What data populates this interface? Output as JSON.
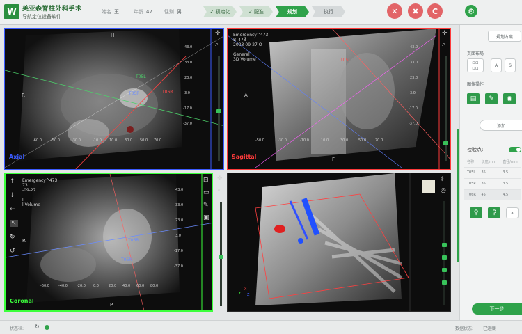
{
  "header": {
    "logo": "W",
    "title": "美亚森脊柱外科手术",
    "subtitle": "导航定位设备软件",
    "patient": {
      "name_label": "姓名",
      "name_value": "王",
      "age_label": "年龄",
      "age_value": "47",
      "sex_label": "性别",
      "sex_value": "男"
    },
    "steps": [
      {
        "label": "初始化",
        "state": "done"
      },
      {
        "label": "配准",
        "state": "done"
      },
      {
        "label": "规划",
        "state": "active"
      },
      {
        "label": "执行",
        "state": "pending"
      }
    ],
    "buttons": [
      {
        "name": "tools-icon",
        "glyph": "✕"
      },
      {
        "name": "robot-arm-icon",
        "glyph": "✖"
      },
      {
        "name": "camera-icon",
        "glyph": "C"
      },
      {
        "name": "tracker-icon",
        "glyph": "⚙"
      }
    ]
  },
  "viewports": {
    "common": {
      "emergency": "Emergency^473",
      "id": "B_473",
      "date": "2023-09-27 O",
      "series1": "General",
      "series2": "3D Volume"
    },
    "axial": {
      "label": "Axial",
      "label_color": "#3b5bff",
      "orient_top": "H",
      "orient_left": "R",
      "scale": [
        "43.0",
        "33.0",
        "23.0",
        "3.0",
        "-17.0",
        "-37.0"
      ],
      "ticks": [
        "-60.0",
        "-50.0",
        "-30.0",
        "-10.0",
        "10.0",
        "30.0",
        "50.0",
        "70.0"
      ],
      "screw_labels": [
        "T05L",
        "T05R",
        "T06R"
      ]
    },
    "sagittal": {
      "label": "Sagittal",
      "label_color": "#ff3b3b",
      "orient_left": "A",
      "orient_bottom": "F",
      "scale": [
        "43.0",
        "33.0",
        "23.0",
        "3.0",
        "-17.0",
        "-37.0"
      ],
      "ticks": [
        "-50.0",
        "-30.0",
        "-10.0",
        "10.0",
        "30.0",
        "50.0",
        "70.0"
      ],
      "screw_labels": [
        "T05L"
      ]
    },
    "coronal": {
      "label": "Coronal",
      "label_color": "#3bff3b",
      "emergency": "Emergency^473",
      "id": "73",
      "date": "-09-27",
      "series1": "l",
      "series2": "l Volume",
      "orient_left": "R",
      "orient_bottom": "P",
      "scale": [
        "43.0",
        "33.0",
        "23.0",
        "3.0",
        "-17.0",
        "-37.0"
      ],
      "ticks": [
        "-60.0",
        "-40.0",
        "-20.0",
        "0.0",
        "20.0",
        "40.0",
        "60.0",
        "80.0"
      ],
      "screw_labels": [
        "T06R",
        "T05R"
      ]
    },
    "volume3d": {
      "axis_labels": [
        "X",
        "Y",
        "Z"
      ]
    }
  },
  "panel": {
    "template_btn": "规划方案",
    "layout_heading": "页面布局",
    "layout_buttons": [
      "A",
      "S"
    ],
    "image_ops_heading": "图像操作",
    "add_btn": "添加",
    "checkpoints_heading": "检验点:",
    "table_headers": [
      "名称",
      "长度/mm",
      "直径/mm"
    ],
    "table_rows": [
      [
        "T05L",
        "35",
        "3.5"
      ],
      [
        "T05R",
        "35",
        "3.5"
      ],
      [
        "T06R",
        "45",
        "4.5"
      ]
    ],
    "next_btn": "下一步"
  },
  "footer": {
    "status_label": "状态栏:",
    "connection_label": "数据状态:",
    "connection_value": "已连接"
  }
}
